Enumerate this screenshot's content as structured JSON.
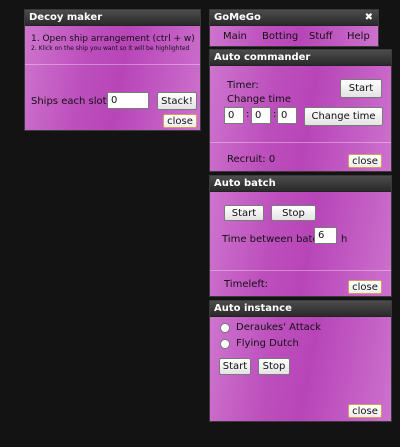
{
  "decoy_maker": {
    "title": "Decoy maker",
    "instruction_1": "1. Open ship arrangement (ctrl + w)",
    "instruction_2": "2. Klick on the ship you want so it will be highlighted",
    "ships_label": "Ships each slot:",
    "ships_value": "0",
    "stack_label": "Stack!",
    "close_label": "close"
  },
  "gomego": {
    "title": "GoMeGo",
    "close_glyph": "✖",
    "menu": [
      "Main",
      "Botting",
      "Stuff",
      "Help"
    ]
  },
  "auto_commander": {
    "title": "Auto commander",
    "timer_label": "Timer:",
    "start_label": "Start",
    "change_time_label": "Change time",
    "hours": "0",
    "minutes": "0",
    "seconds": "0",
    "sep": ":",
    "change_time_button": "Change time",
    "recruit_text": "Recruit: 0",
    "close_label": "close"
  },
  "auto_batch": {
    "title": "Auto batch",
    "start_label": "Start",
    "stop_label": "Stop",
    "time_between_label": "Time between batch:",
    "time_between_value": "6",
    "unit": "h",
    "timeleft_label": "Timeleft:",
    "close_label": "close"
  },
  "auto_instance": {
    "title": "Auto instance",
    "options": [
      "Deraukes' Attack",
      "Flying Dutch"
    ],
    "start_label": "Start",
    "stop_label": "Stop",
    "close_label": "close"
  }
}
